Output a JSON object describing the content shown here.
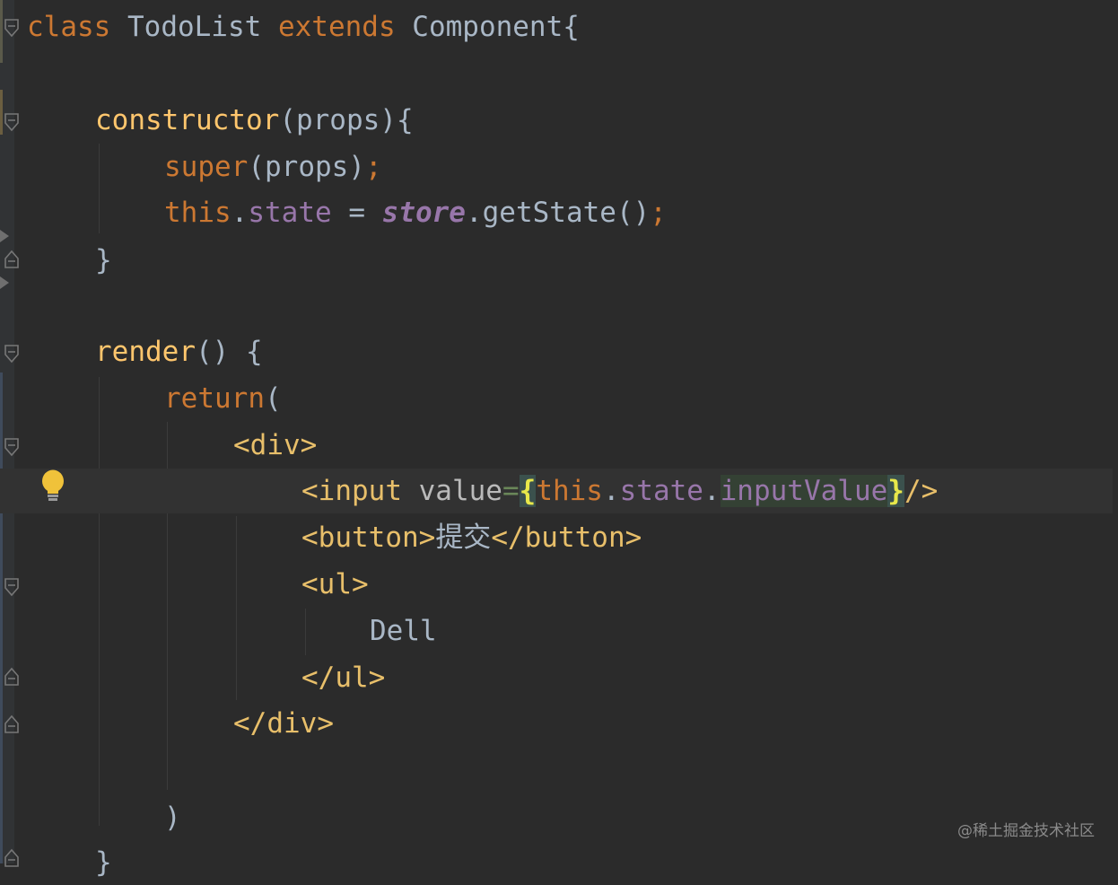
{
  "code": {
    "l1": {
      "kw1": "class",
      "name": " TodoList ",
      "kw2": "extends",
      "rest": " Component{"
    },
    "l2": {
      "fn": "constructor",
      "rest": "(props){"
    },
    "l3": {
      "kw": "super",
      "rest": "(props)",
      "semi": ";"
    },
    "l4": {
      "this": "this",
      "dot1": ".",
      "state": "state",
      "eq": " = ",
      "store": "store",
      "call": ".getState()",
      "semi": ";"
    },
    "l5": {
      "text": "}"
    },
    "l6": {
      "fn": "render",
      "rest": "() {"
    },
    "l7": {
      "kw": "return",
      "rest": "("
    },
    "l8": {
      "tag": "<div>"
    },
    "l9": {
      "tag_open": "<input",
      "attr": " value",
      "eq": "=",
      "brace_open": "{",
      "this": "this",
      "dot1": ".",
      "state": "state",
      "dot2": ".",
      "input_value": "inputValue",
      "brace_close": "}",
      "tag_close": "/>"
    },
    "l10": {
      "tag_open": "<button>",
      "text": "提交",
      "tag_close": "</button>"
    },
    "l11": {
      "tag": "<ul>"
    },
    "l12": {
      "text": "Dell"
    },
    "l13": {
      "tag": "</ul>"
    },
    "l14": {
      "tag": "</div>"
    },
    "l15": {
      "text": ")"
    },
    "l16": {
      "text": "}"
    }
  },
  "watermark": "@稀土掘金技术社区",
  "icons": [
    "fold-icon",
    "lightbulb-icon",
    "warning-arrow-icon"
  ]
}
